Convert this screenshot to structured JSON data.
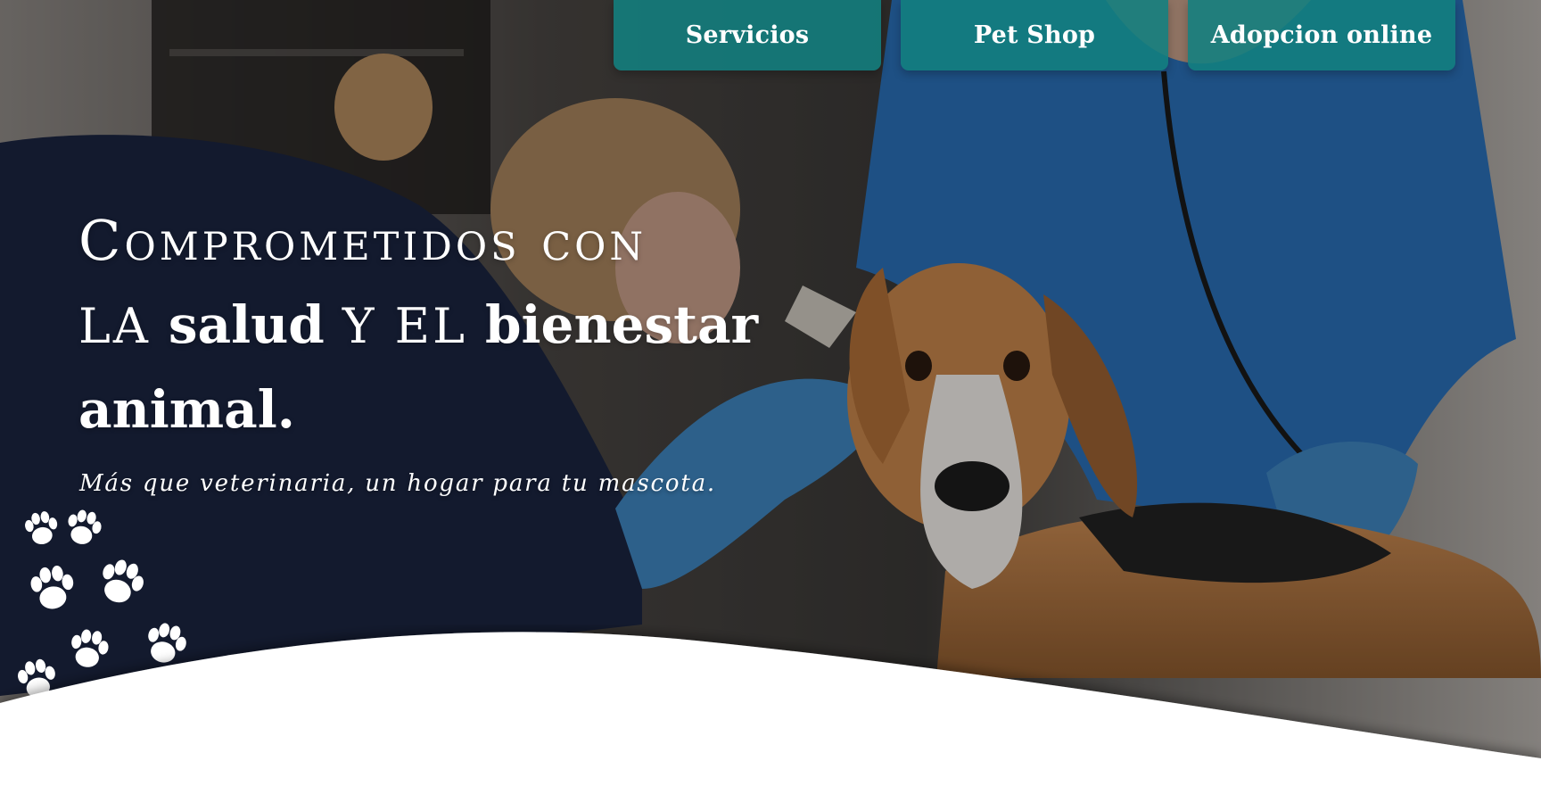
{
  "nav": {
    "items": [
      {
        "label": "Servicios"
      },
      {
        "label": "Pet Shop"
      },
      {
        "label": "Adopcion online"
      }
    ],
    "button_color": "#128080"
  },
  "hero": {
    "headline": {
      "line1": "Comprometidos con",
      "line2_a": "LA",
      "line2_b": "salud",
      "line2_c": "Y EL",
      "line2_d": "bienestar",
      "line3": "animal."
    },
    "tagline": "Más que veterinaria, un hogar para tu mascota.",
    "background": "veterinarians examining a beagle dog",
    "paw_icon": "paw-print-icon"
  }
}
